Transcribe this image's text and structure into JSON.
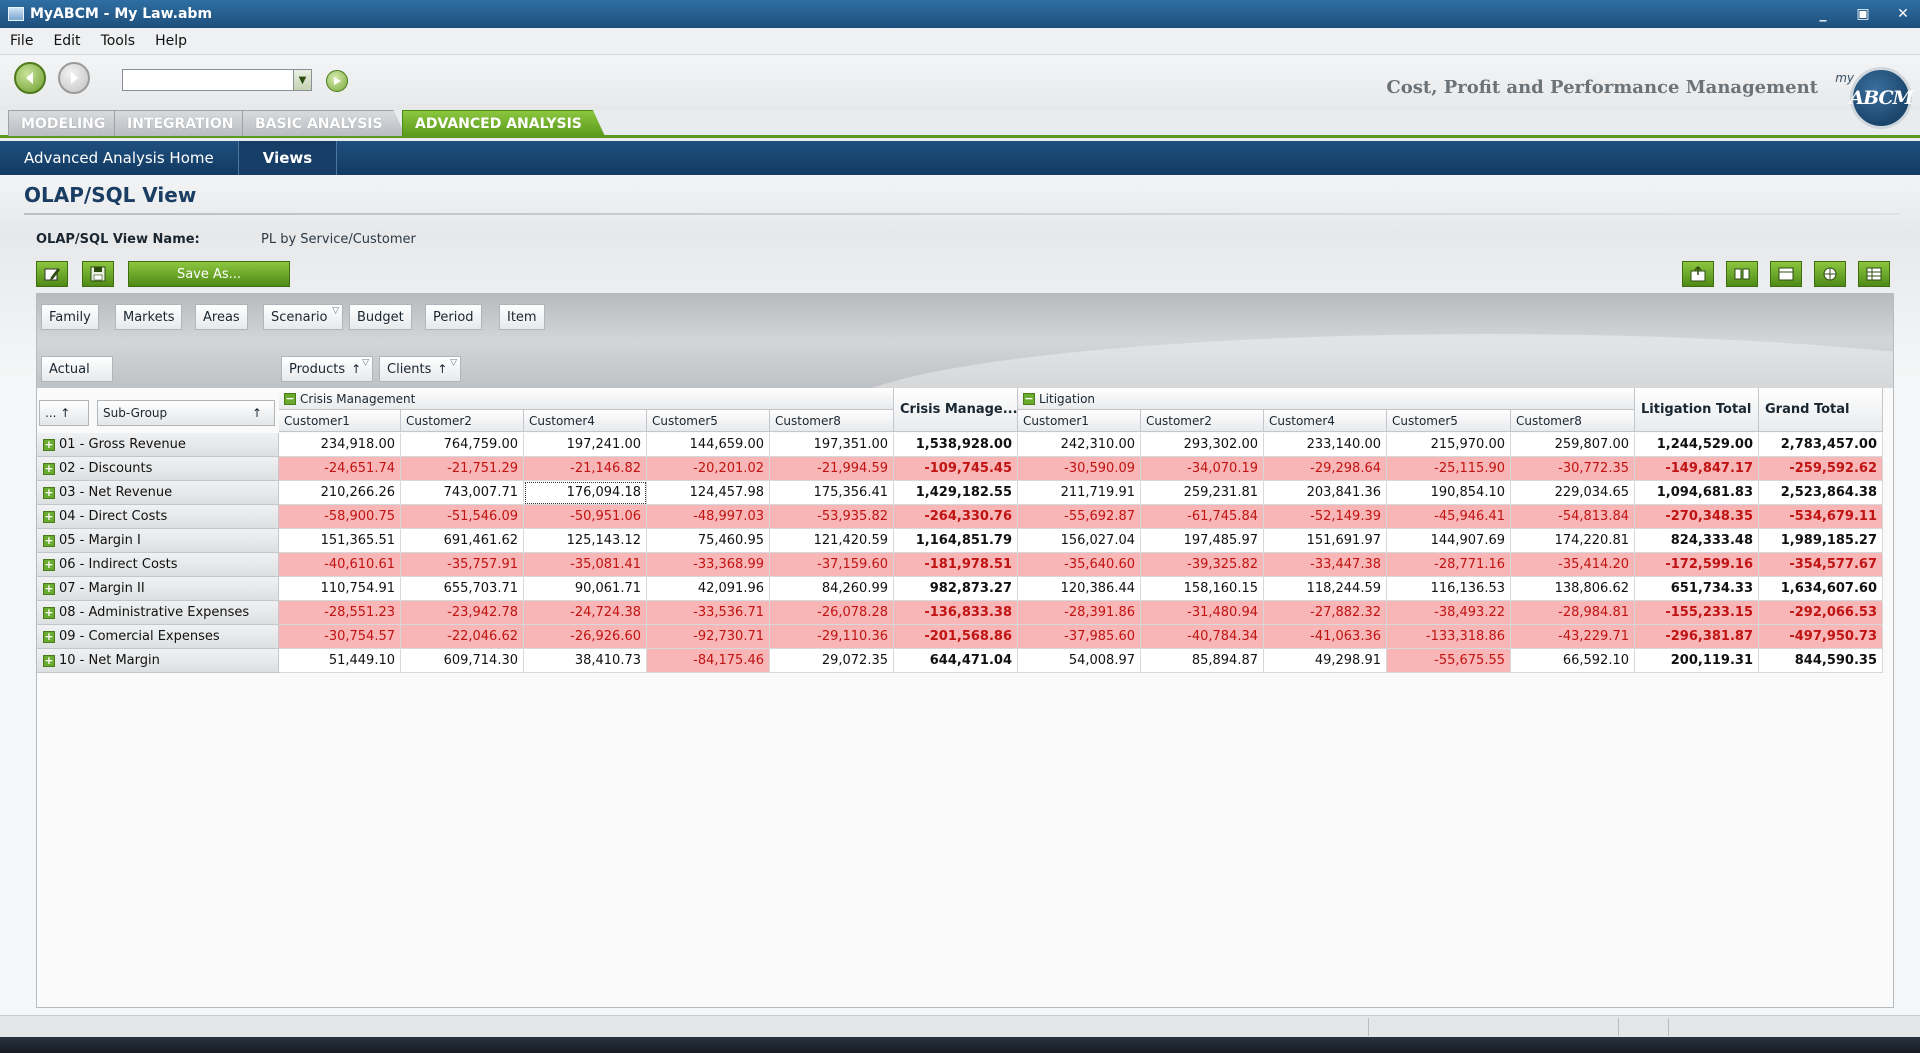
{
  "window": {
    "title": "MyABCM - My Law.abm",
    "minimize": "_",
    "restore": "▣",
    "close": "✕"
  },
  "menu": [
    {
      "label": "File"
    },
    {
      "label": "Edit"
    },
    {
      "label": "Tools"
    },
    {
      "label": "Help"
    }
  ],
  "toolbar": {
    "combo_value": "",
    "tagline": "Cost, Profit and Performance Management",
    "logo_text": "ABCM",
    "logo_my": "my"
  },
  "tabs": [
    {
      "label": "MODELING",
      "active": false
    },
    {
      "label": "INTEGRATION",
      "active": false
    },
    {
      "label": "BASIC ANALYSIS",
      "active": false
    },
    {
      "label": "ADVANCED ANALYSIS",
      "active": true
    }
  ],
  "subnav": [
    {
      "label": "Advanced Analysis Home",
      "active": false
    },
    {
      "label": "Views",
      "active": true
    }
  ],
  "page": {
    "title": "OLAP/SQL View",
    "view_name_label": "OLAP/SQL View Name:",
    "view_name_value": "PL by Service/Customer",
    "save_as_label": "Save As..."
  },
  "filter_fields": [
    "Family",
    "Markets",
    "Areas",
    "Scenario",
    "Budget",
    "Period",
    "Item"
  ],
  "row_area_field": "Actual",
  "column_fields": [
    "Products",
    "Clients"
  ],
  "row_headers": {
    "sort": "...",
    "subgroup": "Sub-Group"
  },
  "groups": [
    {
      "name": "Crisis Management",
      "total_label": "Crisis Manage...",
      "customers": [
        "Customer1",
        "Customer2",
        "Customer4",
        "Customer5",
        "Customer8"
      ]
    },
    {
      "name": "Litigation",
      "total_label": "Litigation Total",
      "customers": [
        "Customer1",
        "Customer2",
        "Customer4",
        "Customer5",
        "Customer8"
      ]
    }
  ],
  "grand_total_label": "Grand Total",
  "rows": [
    {
      "label": "01 - Gross Revenue",
      "values": [
        "234,918.00",
        "764,759.00",
        "197,241.00",
        "144,659.00",
        "197,351.00",
        "1,538,928.00",
        "242,310.00",
        "293,302.00",
        "233,140.00",
        "215,970.00",
        "259,807.00",
        "1,244,529.00",
        "2,783,457.00"
      ]
    },
    {
      "label": "02 - Discounts",
      "values": [
        "-24,651.74",
        "-21,751.29",
        "-21,146.82",
        "-20,201.02",
        "-21,994.59",
        "-109,745.45",
        "-30,590.09",
        "-34,070.19",
        "-29,298.64",
        "-25,115.90",
        "-30,772.35",
        "-149,847.17",
        "-259,592.62"
      ]
    },
    {
      "label": "03 - Net Revenue",
      "values": [
        "210,266.26",
        "743,007.71",
        "176,094.18",
        "124,457.98",
        "175,356.41",
        "1,429,182.55",
        "211,719.91",
        "259,231.81",
        "203,841.36",
        "190,854.10",
        "229,034.65",
        "1,094,681.83",
        "2,523,864.38"
      ]
    },
    {
      "label": "04 - Direct Costs",
      "values": [
        "-58,900.75",
        "-51,546.09",
        "-50,951.06",
        "-48,997.03",
        "-53,935.82",
        "-264,330.76",
        "-55,692.87",
        "-61,745.84",
        "-52,149.39",
        "-45,946.41",
        "-54,813.84",
        "-270,348.35",
        "-534,679.11"
      ]
    },
    {
      "label": "05 - Margin I",
      "values": [
        "151,365.51",
        "691,461.62",
        "125,143.12",
        "75,460.95",
        "121,420.59",
        "1,164,851.79",
        "156,027.04",
        "197,485.97",
        "151,691.97",
        "144,907.69",
        "174,220.81",
        "824,333.48",
        "1,989,185.27"
      ]
    },
    {
      "label": "06 - Indirect Costs",
      "values": [
        "-40,610.61",
        "-35,757.91",
        "-35,081.41",
        "-33,368.99",
        "-37,159.60",
        "-181,978.51",
        "-35,640.60",
        "-39,325.82",
        "-33,447.38",
        "-28,771.16",
        "-35,414.20",
        "-172,599.16",
        "-354,577.67"
      ]
    },
    {
      "label": "07 - Margin II",
      "values": [
        "110,754.91",
        "655,703.71",
        "90,061.71",
        "42,091.96",
        "84,260.99",
        "982,873.27",
        "120,386.44",
        "158,160.15",
        "118,244.59",
        "116,136.53",
        "138,806.62",
        "651,734.33",
        "1,634,607.60"
      ]
    },
    {
      "label": "08 - Administrative Expenses",
      "values": [
        "-28,551.23",
        "-23,942.78",
        "-24,724.38",
        "-33,536.71",
        "-26,078.28",
        "-136,833.38",
        "-28,391.86",
        "-31,480.94",
        "-27,882.32",
        "-38,493.22",
        "-28,984.81",
        "-155,233.15",
        "-292,066.53"
      ]
    },
    {
      "label": "09 - Comercial Expenses",
      "values": [
        "-30,754.57",
        "-22,046.62",
        "-26,926.60",
        "-92,730.71",
        "-29,110.36",
        "-201,568.86",
        "-37,985.60",
        "-40,784.34",
        "-41,063.36",
        "-133,318.86",
        "-43,229.71",
        "-296,381.87",
        "-497,950.73"
      ]
    },
    {
      "label": "10 - Net Margin",
      "values": [
        "51,449.10",
        "609,714.30",
        "38,410.73",
        "-84,175.46",
        "29,072.35",
        "644,471.04",
        "54,008.97",
        "85,894.87",
        "49,298.91",
        "-55,675.55",
        "66,592.10",
        "200,119.31",
        "844,590.35"
      ]
    }
  ],
  "colors": {
    "negative_bg": "#f8b6b6",
    "negative_text": "#c01313",
    "accent_green": "#5a9a1c",
    "nav_blue": "#1f4f7e"
  }
}
